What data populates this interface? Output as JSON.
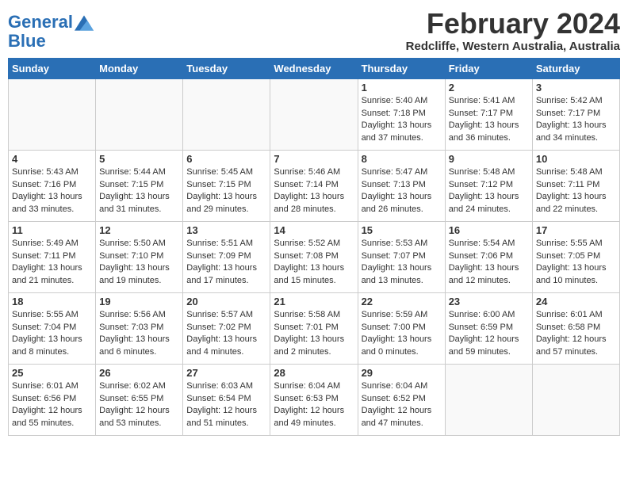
{
  "header": {
    "logo_line1": "General",
    "logo_line2": "Blue",
    "month_title": "February 2024",
    "location": "Redcliffe, Western Australia, Australia"
  },
  "weekdays": [
    "Sunday",
    "Monday",
    "Tuesday",
    "Wednesday",
    "Thursday",
    "Friday",
    "Saturday"
  ],
  "weeks": [
    [
      {
        "day": "",
        "info": ""
      },
      {
        "day": "",
        "info": ""
      },
      {
        "day": "",
        "info": ""
      },
      {
        "day": "",
        "info": ""
      },
      {
        "day": "1",
        "info": "Sunrise: 5:40 AM\nSunset: 7:18 PM\nDaylight: 13 hours\nand 37 minutes."
      },
      {
        "day": "2",
        "info": "Sunrise: 5:41 AM\nSunset: 7:17 PM\nDaylight: 13 hours\nand 36 minutes."
      },
      {
        "day": "3",
        "info": "Sunrise: 5:42 AM\nSunset: 7:17 PM\nDaylight: 13 hours\nand 34 minutes."
      }
    ],
    [
      {
        "day": "4",
        "info": "Sunrise: 5:43 AM\nSunset: 7:16 PM\nDaylight: 13 hours\nand 33 minutes."
      },
      {
        "day": "5",
        "info": "Sunrise: 5:44 AM\nSunset: 7:15 PM\nDaylight: 13 hours\nand 31 minutes."
      },
      {
        "day": "6",
        "info": "Sunrise: 5:45 AM\nSunset: 7:15 PM\nDaylight: 13 hours\nand 29 minutes."
      },
      {
        "day": "7",
        "info": "Sunrise: 5:46 AM\nSunset: 7:14 PM\nDaylight: 13 hours\nand 28 minutes."
      },
      {
        "day": "8",
        "info": "Sunrise: 5:47 AM\nSunset: 7:13 PM\nDaylight: 13 hours\nand 26 minutes."
      },
      {
        "day": "9",
        "info": "Sunrise: 5:48 AM\nSunset: 7:12 PM\nDaylight: 13 hours\nand 24 minutes."
      },
      {
        "day": "10",
        "info": "Sunrise: 5:48 AM\nSunset: 7:11 PM\nDaylight: 13 hours\nand 22 minutes."
      }
    ],
    [
      {
        "day": "11",
        "info": "Sunrise: 5:49 AM\nSunset: 7:11 PM\nDaylight: 13 hours\nand 21 minutes."
      },
      {
        "day": "12",
        "info": "Sunrise: 5:50 AM\nSunset: 7:10 PM\nDaylight: 13 hours\nand 19 minutes."
      },
      {
        "day": "13",
        "info": "Sunrise: 5:51 AM\nSunset: 7:09 PM\nDaylight: 13 hours\nand 17 minutes."
      },
      {
        "day": "14",
        "info": "Sunrise: 5:52 AM\nSunset: 7:08 PM\nDaylight: 13 hours\nand 15 minutes."
      },
      {
        "day": "15",
        "info": "Sunrise: 5:53 AM\nSunset: 7:07 PM\nDaylight: 13 hours\nand 13 minutes."
      },
      {
        "day": "16",
        "info": "Sunrise: 5:54 AM\nSunset: 7:06 PM\nDaylight: 13 hours\nand 12 minutes."
      },
      {
        "day": "17",
        "info": "Sunrise: 5:55 AM\nSunset: 7:05 PM\nDaylight: 13 hours\nand 10 minutes."
      }
    ],
    [
      {
        "day": "18",
        "info": "Sunrise: 5:55 AM\nSunset: 7:04 PM\nDaylight: 13 hours\nand 8 minutes."
      },
      {
        "day": "19",
        "info": "Sunrise: 5:56 AM\nSunset: 7:03 PM\nDaylight: 13 hours\nand 6 minutes."
      },
      {
        "day": "20",
        "info": "Sunrise: 5:57 AM\nSunset: 7:02 PM\nDaylight: 13 hours\nand 4 minutes."
      },
      {
        "day": "21",
        "info": "Sunrise: 5:58 AM\nSunset: 7:01 PM\nDaylight: 13 hours\nand 2 minutes."
      },
      {
        "day": "22",
        "info": "Sunrise: 5:59 AM\nSunset: 7:00 PM\nDaylight: 13 hours\nand 0 minutes."
      },
      {
        "day": "23",
        "info": "Sunrise: 6:00 AM\nSunset: 6:59 PM\nDaylight: 12 hours\nand 59 minutes."
      },
      {
        "day": "24",
        "info": "Sunrise: 6:01 AM\nSunset: 6:58 PM\nDaylight: 12 hours\nand 57 minutes."
      }
    ],
    [
      {
        "day": "25",
        "info": "Sunrise: 6:01 AM\nSunset: 6:56 PM\nDaylight: 12 hours\nand 55 minutes."
      },
      {
        "day": "26",
        "info": "Sunrise: 6:02 AM\nSunset: 6:55 PM\nDaylight: 12 hours\nand 53 minutes."
      },
      {
        "day": "27",
        "info": "Sunrise: 6:03 AM\nSunset: 6:54 PM\nDaylight: 12 hours\nand 51 minutes."
      },
      {
        "day": "28",
        "info": "Sunrise: 6:04 AM\nSunset: 6:53 PM\nDaylight: 12 hours\nand 49 minutes."
      },
      {
        "day": "29",
        "info": "Sunrise: 6:04 AM\nSunset: 6:52 PM\nDaylight: 12 hours\nand 47 minutes."
      },
      {
        "day": "",
        "info": ""
      },
      {
        "day": "",
        "info": ""
      }
    ]
  ]
}
